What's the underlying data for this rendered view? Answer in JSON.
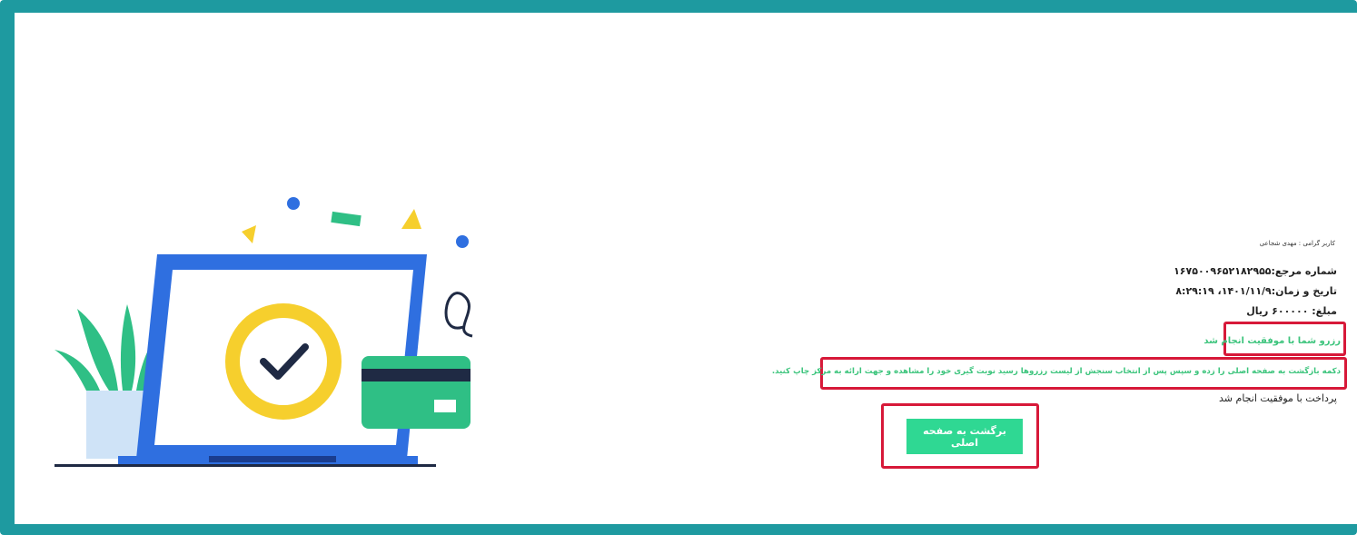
{
  "receipt": {
    "greeting": "کاربر گرامی : مهدی شجاعی",
    "reference": "شماره مرجع:۱۶۷۵۰۰۹۶۵۲۱۸۲۹۵۵",
    "datetime": "تاریخ و زمان:۱۴۰۱/۱۱/۹، ۸:۲۹:۱۹",
    "amount": "مبلغ: ۶۰۰۰۰۰ ریال",
    "success_message": "رزرو شما با موفقیت انجام شد",
    "instruction": "دکمه بازگشت به صفحه اصلی را زده و سپس پس از انتخاب سنجش از لیست رزروها رسید نوبت گیری خود را مشاهده و جهت ارائه به مرکز چاپ کنید.",
    "payment_status": "پرداخت با موفقیت انجام شد",
    "back_button": "برگشت به صفحه اصلی"
  },
  "colors": {
    "frame": "#1e9aa0",
    "highlight": "#d71939",
    "success_text": "#3cc47c",
    "button": "#2fd893",
    "laptop_blue": "#2f6fe0",
    "badge_yellow": "#f6cf2d",
    "card_green": "#2fbf85"
  },
  "illustration": {
    "icons": [
      "laptop-icon",
      "success-badge-icon",
      "checkmark-icon",
      "credit-card-icon",
      "plant-icon",
      "confetti-icon"
    ]
  }
}
